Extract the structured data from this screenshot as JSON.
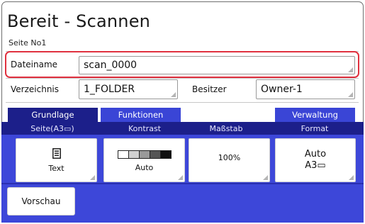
{
  "header": {
    "title": "Bereit - Scannen",
    "subtitle": "Seite No1"
  },
  "fields": {
    "filename": {
      "label": "Dateiname",
      "value": "scan_0000"
    },
    "folder": {
      "label": "Verzeichnis",
      "value": "1_FOLDER"
    },
    "owner": {
      "label": "Besitzer",
      "value": "Owner-1"
    }
  },
  "tabs": [
    "Grundlage",
    "Funktionen",
    "Verwaltung"
  ],
  "columns": {
    "page": {
      "header": "Seite(A3▭)",
      "value": "Text",
      "icon": "document-icon"
    },
    "contrast": {
      "header": "Kontrast",
      "value": "Auto"
    },
    "scale": {
      "header": "Maßstab",
      "value": "100%"
    },
    "format": {
      "header": "Format",
      "value": "Auto",
      "value2": "A3▭"
    }
  },
  "preview_button": "Vorschau",
  "colors": {
    "accent_dark": "#1c1f8a",
    "accent": "#3d47d9",
    "highlight": "#e0313f"
  }
}
